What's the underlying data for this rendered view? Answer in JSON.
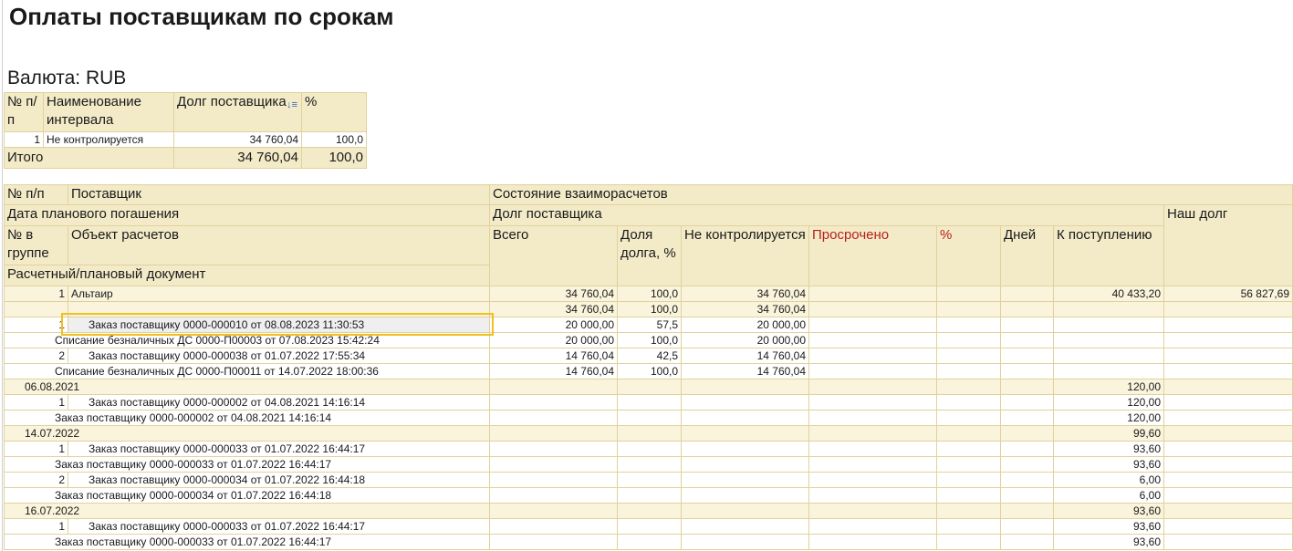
{
  "report": {
    "title": "Оплаты поставщикам по срокам",
    "currency": "Валюта: RUB"
  },
  "summary": {
    "headers": {
      "num": "№ п/п",
      "interval": "Наименование интервала",
      "debt": "Долг поставщика",
      "pct": "%"
    },
    "rows": [
      {
        "num": "1",
        "interval": "Не контролируется",
        "debt": "34 760,04",
        "pct": "100,0"
      }
    ],
    "total": {
      "label": "Итого",
      "debt": "34 760,04",
      "pct": "100,0"
    }
  },
  "main": {
    "headers": {
      "num": "№ п/п",
      "supplier": "Поставщик",
      "settlement_state": "Состояние взаиморасчетов",
      "planned_date": "Дата планового погашения",
      "supplier_debt": "Долг поставщика",
      "our_debt": "Наш долг",
      "group_num": "№ в группе",
      "settlement_object": "Объект расчетов",
      "total": "Всего",
      "debt_share": "Доля долга, %",
      "not_controlled": "Не контролируется",
      "overdue": "Просрочено",
      "pct": "%",
      "days": "Дней",
      "to_receive": "К поступлению",
      "document": "Расчетный/плановый документ"
    },
    "rows": [
      {
        "type": "group",
        "n": "1",
        "label": "Альтаир",
        "total": "34 760,04",
        "share": "100,0",
        "nc": "34 760,04",
        "over": "",
        "pct": "",
        "days": "",
        "recv": "40 433,20",
        "our": "56 827,69"
      },
      {
        "type": "group",
        "n": "",
        "label": "",
        "total": "34 760,04",
        "share": "100,0",
        "nc": "34 760,04",
        "over": "",
        "pct": "",
        "days": "",
        "recv": "",
        "our": ""
      },
      {
        "type": "obj",
        "n": "1",
        "label": "Заказ поставщику 0000-000010 от 08.08.2023 11:30:53",
        "total": "20 000,00",
        "share": "57,5",
        "nc": "20 000,00",
        "over": "",
        "pct": "",
        "days": "",
        "recv": "",
        "our": ""
      },
      {
        "type": "doc",
        "n": "",
        "label": "Списание безналичных ДС 0000-П00003 от 07.08.2023 15:42:24",
        "total": "20 000,00",
        "share": "100,0",
        "nc": "20 000,00",
        "over": "",
        "pct": "",
        "days": "",
        "recv": "",
        "our": ""
      },
      {
        "type": "obj",
        "n": "2",
        "label": "Заказ поставщику 0000-000038 от 01.07.2022 17:55:34",
        "total": "14 760,04",
        "share": "42,5",
        "nc": "14 760,04",
        "over": "",
        "pct": "",
        "days": "",
        "recv": "",
        "our": ""
      },
      {
        "type": "doc",
        "n": "",
        "label": "Списание безналичных ДС 0000-П00011 от 14.07.2022 18:00:36",
        "total": "14 760,04",
        "share": "100,0",
        "nc": "14 760,04",
        "over": "",
        "pct": "",
        "days": "",
        "recv": "",
        "our": ""
      },
      {
        "type": "date",
        "n": "",
        "label": "06.08.2021",
        "total": "",
        "share": "",
        "nc": "",
        "over": "",
        "pct": "",
        "days": "",
        "recv": "120,00",
        "our": ""
      },
      {
        "type": "obj",
        "n": "1",
        "label": "Заказ поставщику 0000-000002 от 04.08.2021 14:16:14",
        "total": "",
        "share": "",
        "nc": "",
        "over": "",
        "pct": "",
        "days": "",
        "recv": "120,00",
        "our": ""
      },
      {
        "type": "doc",
        "n": "",
        "label": "Заказ поставщику 0000-000002 от 04.08.2021 14:16:14",
        "total": "",
        "share": "",
        "nc": "",
        "over": "",
        "pct": "",
        "days": "",
        "recv": "120,00",
        "our": ""
      },
      {
        "type": "date",
        "n": "",
        "label": "14.07.2022",
        "total": "",
        "share": "",
        "nc": "",
        "over": "",
        "pct": "",
        "days": "",
        "recv": "99,60",
        "our": ""
      },
      {
        "type": "obj",
        "n": "1",
        "label": "Заказ поставщику 0000-000033 от 01.07.2022 16:44:17",
        "total": "",
        "share": "",
        "nc": "",
        "over": "",
        "pct": "",
        "days": "",
        "recv": "93,60",
        "our": ""
      },
      {
        "type": "doc",
        "n": "",
        "label": "Заказ поставщику 0000-000033 от 01.07.2022 16:44:17",
        "total": "",
        "share": "",
        "nc": "",
        "over": "",
        "pct": "",
        "days": "",
        "recv": "93,60",
        "our": ""
      },
      {
        "type": "obj",
        "n": "2",
        "label": "Заказ поставщику 0000-000034 от 01.07.2022 16:44:18",
        "total": "",
        "share": "",
        "nc": "",
        "over": "",
        "pct": "",
        "days": "",
        "recv": "6,00",
        "our": ""
      },
      {
        "type": "doc",
        "n": "",
        "label": "Заказ поставщику 0000-000034 от 01.07.2022 16:44:18",
        "total": "",
        "share": "",
        "nc": "",
        "over": "",
        "pct": "",
        "days": "",
        "recv": "6,00",
        "our": ""
      },
      {
        "type": "date",
        "n": "",
        "label": "16.07.2022",
        "total": "",
        "share": "",
        "nc": "",
        "over": "",
        "pct": "",
        "days": "",
        "recv": "93,60",
        "our": ""
      },
      {
        "type": "obj",
        "n": "1",
        "label": "Заказ поставщику 0000-000033 от 01.07.2022 16:44:17",
        "total": "",
        "share": "",
        "nc": "",
        "over": "",
        "pct": "",
        "days": "",
        "recv": "93,60",
        "our": ""
      },
      {
        "type": "doc",
        "n": "",
        "label": "Заказ поставщику 0000-000033 от 01.07.2022 16:44:17",
        "total": "",
        "share": "",
        "nc": "",
        "over": "",
        "pct": "",
        "days": "",
        "recv": "93,60",
        "our": ""
      }
    ]
  }
}
